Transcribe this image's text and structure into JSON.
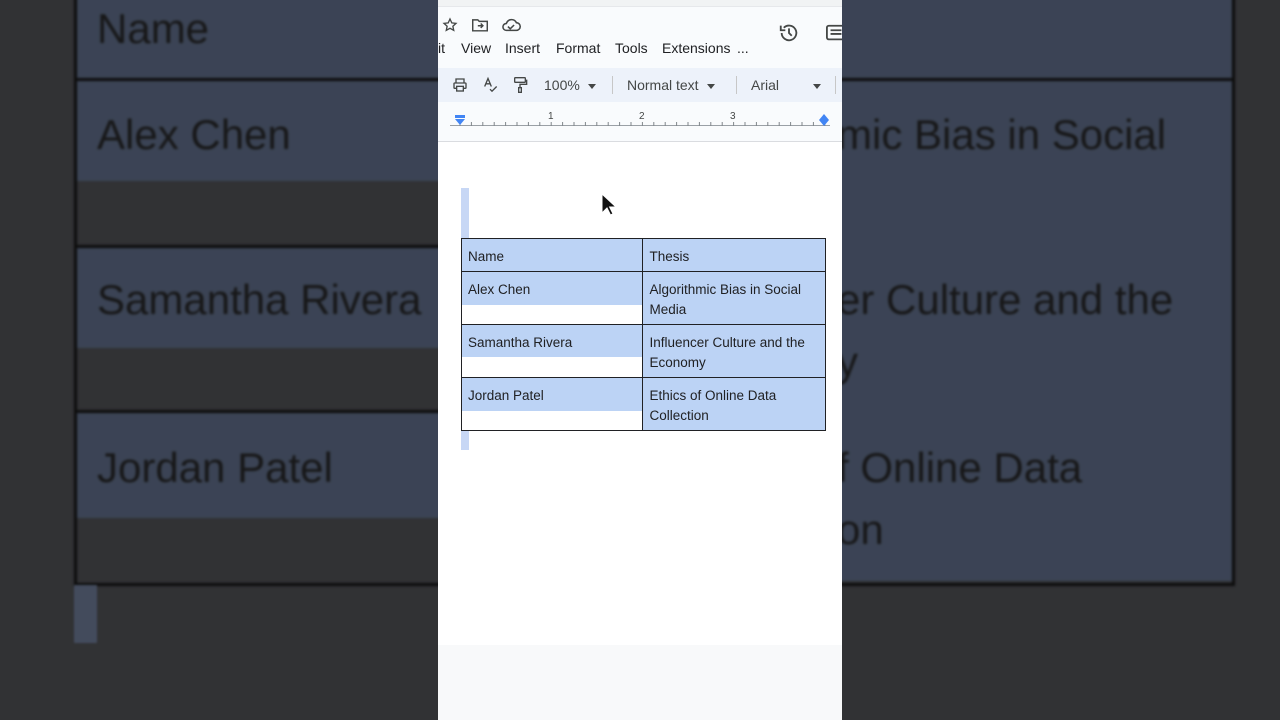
{
  "background": {
    "table_left_cells": [
      "Name",
      "Alex Chen",
      "Samantha Rivera",
      "Jordan Patel"
    ],
    "table_right_fragments": [
      "mic Bias in Social",
      "er Culture and the",
      "y",
      "f Online Data",
      "on"
    ]
  },
  "toolbar_icons": [
    "star-icon",
    "move-to-folder-icon",
    "cloud-status-icon",
    "version-history-icon",
    "comments-icon"
  ],
  "menu": {
    "items": [
      "it",
      "View",
      "Insert",
      "Format",
      "Tools",
      "Extensions",
      "..."
    ]
  },
  "format_toolbar": {
    "print_icon": "print-icon",
    "spellcheck_icon": "spellcheck-icon",
    "paint_format_icon": "paint-format-icon",
    "zoom": "100%",
    "style": "Normal text",
    "font": "Arial"
  },
  "ruler": {
    "marks": [
      "1",
      "2",
      "3"
    ]
  },
  "table": {
    "headers": [
      "Name",
      "Thesis"
    ],
    "rows": [
      {
        "name": "Alex Chen",
        "thesis": "Algorithmic Bias in Social Media"
      },
      {
        "name": "Samantha Rivera",
        "thesis": "Influencer Culture and the Economy"
      },
      {
        "name": "Jordan Patel",
        "thesis": "Ethics of Online Data Collection"
      }
    ]
  },
  "colors": {
    "selection": "#bcd3f5",
    "toolbar_bg": "#edf2fa",
    "page_bg": "#ffffff"
  }
}
